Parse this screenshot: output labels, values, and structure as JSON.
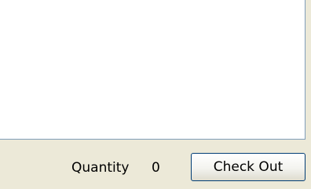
{
  "footer": {
    "quantity_label": "Quantity",
    "quantity_value": "0",
    "checkout_label": "Check Out"
  },
  "colors": {
    "window_background": "#ece9d8",
    "panel_background": "#ffffff",
    "panel_border": "#7f9db9",
    "button_border": "#003c74"
  }
}
